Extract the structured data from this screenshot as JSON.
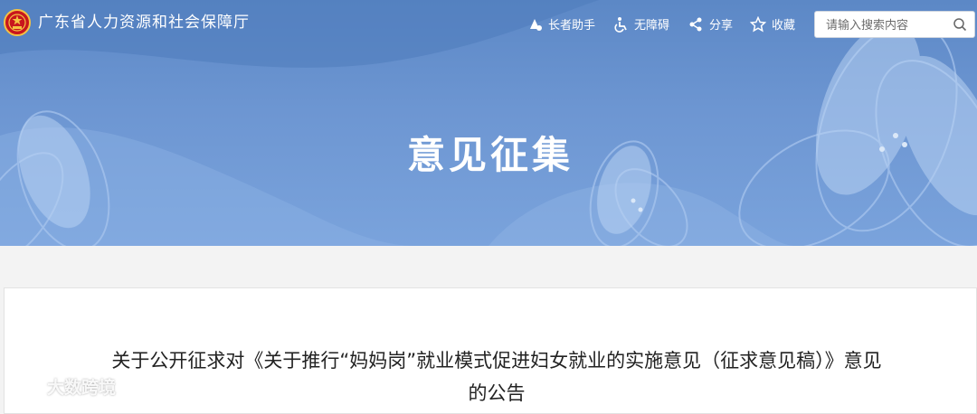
{
  "header": {
    "site_name": "广东省人力资源和社会保障厅",
    "tools": [
      {
        "label": "长者助手",
        "icon": "elder-assist-icon"
      },
      {
        "label": "无障碍",
        "icon": "wheelchair-icon"
      },
      {
        "label": "分享",
        "icon": "share-icon"
      },
      {
        "label": "收藏",
        "icon": "star-icon"
      }
    ],
    "search": {
      "placeholder": "请输入搜索内容",
      "icon": "search-icon"
    }
  },
  "hero": {
    "title": "意见征集"
  },
  "notice": {
    "title_line1": "关于公开征求对《关于推行“妈妈岗”就业模式促进妇女就业的实施意见（征求意见稿）》意见",
    "title_line2": "的公告"
  },
  "watermark": {
    "text": "大数跨境"
  },
  "colors": {
    "hero_bg": "#6d96d2",
    "emblem_red": "#c8161d",
    "emblem_gold": "#f5c242"
  }
}
